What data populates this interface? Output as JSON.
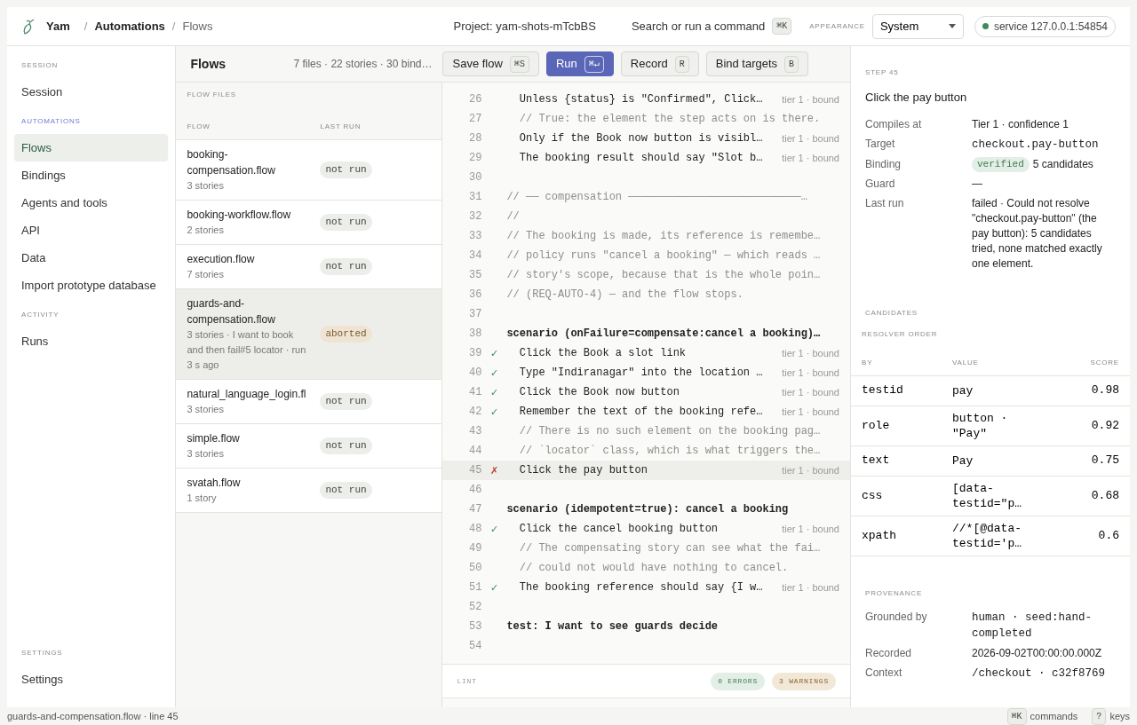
{
  "header": {
    "app": "Yam",
    "breadcrumbs": [
      {
        "separator": "/",
        "label": "Automations"
      },
      {
        "separator": "/",
        "label": "Flows"
      }
    ],
    "project": "Project: yam-shots-mTcbBS",
    "command": {
      "label": "Search or run a command",
      "key": "⌘K"
    },
    "appearance": {
      "label": "APPEARANCE",
      "value": "System"
    },
    "service": {
      "label": "service 127.0.0.1:54854",
      "color": "#3f8a5c"
    }
  },
  "sidebar": [
    {
      "heading": "SESSION",
      "accent": false,
      "items": [
        {
          "label": "Session",
          "selected": false
        }
      ]
    },
    {
      "heading": "AUTOMATIONS",
      "accent": true,
      "items": [
        {
          "label": "Flows",
          "selected": true
        },
        {
          "label": "Bindings",
          "selected": false
        },
        {
          "label": "Agents and tools",
          "selected": false
        },
        {
          "label": "API",
          "selected": false
        },
        {
          "label": "Data",
          "selected": false
        },
        {
          "label": "Import prototype database",
          "selected": false
        }
      ]
    },
    {
      "heading": "ACTIVITY",
      "accent": false,
      "items": [
        {
          "label": "Runs",
          "selected": false
        }
      ]
    }
  ],
  "sidebar_footer": {
    "heading": "SETTINGS",
    "items": [
      {
        "label": "Settings",
        "selected": false
      }
    ]
  },
  "toolbar": {
    "title": "Flows",
    "summary": "7 files · 22 stories · 30 bind…",
    "buttons": [
      {
        "label": "Save flow",
        "key": "⌘S",
        "primary": false
      },
      {
        "label": "Run",
        "key": "⌘↵",
        "primary": true
      },
      {
        "label": "Record",
        "key": "R",
        "primary": false
      },
      {
        "label": "Bind targets",
        "key": "B",
        "primary": false
      }
    ]
  },
  "flow_files": {
    "label": "FLOW FILES",
    "columns": [
      "FLOW",
      "LAST RUN"
    ],
    "rows": [
      {
        "name": "booking-compensation.flow",
        "detail": "3 stories",
        "status": "not run",
        "kind": "idle",
        "selected": false
      },
      {
        "name": "booking-workflow.flow",
        "detail": "2 stories",
        "status": "not run",
        "kind": "idle",
        "selected": false
      },
      {
        "name": "execution.flow",
        "detail": "7 stories",
        "status": "not run",
        "kind": "idle",
        "selected": false
      },
      {
        "name": "guards-and-compensation.flow",
        "detail": "3 stories · I want to book and then fail#5 locator · run 3 s ago",
        "status": "aborted",
        "kind": "aborted",
        "selected": true
      },
      {
        "name": "natural_language_login.fl",
        "detail": "3 stories",
        "status": "not run",
        "kind": "idle",
        "selected": false
      },
      {
        "name": "simple.flow",
        "detail": "3 stories",
        "status": "not run",
        "kind": "idle",
        "selected": false
      },
      {
        "name": "svatah.flow",
        "detail": "1 story",
        "status": "not run",
        "kind": "idle",
        "selected": false
      }
    ]
  },
  "editor": {
    "lines": [
      {
        "n": "26",
        "kind": "step",
        "text": "  Unless {status} is \"Confirmed\", Click…",
        "meta": "tier 1 · bound",
        "selected": false
      },
      {
        "n": "27",
        "kind": "comment",
        "text": "  // True: the element the step acts on is there.",
        "selected": false
      },
      {
        "n": "28",
        "kind": "step",
        "text": "  Only if the Book now button is visibl…",
        "meta": "tier 1 · bound",
        "selected": false
      },
      {
        "n": "29",
        "kind": "step",
        "text": "  The booking result should say \"Slot b…",
        "meta": "tier 1 · bound",
        "selected": false
      },
      {
        "n": "30",
        "kind": "blank",
        "selected": false
      },
      {
        "n": "31",
        "kind": "comment",
        "text": "// ── compensation ───────────────────────────…",
        "selected": false
      },
      {
        "n": "32",
        "kind": "comment",
        "text": "//",
        "selected": false
      },
      {
        "n": "33",
        "kind": "comment",
        "text": "// The booking is made, its reference is remembe…",
        "selected": false
      },
      {
        "n": "34",
        "kind": "comment",
        "text": "// policy runs \"cancel a booking\" — which reads …",
        "selected": false
      },
      {
        "n": "35",
        "kind": "comment",
        "text": "// story's scope, because that is the whole poin…",
        "selected": false
      },
      {
        "n": "36",
        "kind": "comment",
        "text": "// (REQ-AUTO-4) — and the flow stops.",
        "selected": false
      },
      {
        "n": "37",
        "kind": "blank",
        "selected": false
      },
      {
        "n": "38",
        "kind": "heading",
        "text": "scenario (onFailure=compensate:cancel a booking)…",
        "selected": false
      },
      {
        "n": "39",
        "kind": "step",
        "mark": "✓",
        "failed": false,
        "text": "  Click the Book a slot link",
        "meta": "tier 1 · bound",
        "selected": false
      },
      {
        "n": "40",
        "kind": "step",
        "mark": "✓",
        "failed": false,
        "text": "  Type \"Indiranagar\" into the location …",
        "meta": "tier 1 · bound",
        "selected": false
      },
      {
        "n": "41",
        "kind": "step",
        "mark": "✓",
        "failed": false,
        "text": "  Click the Book now button",
        "meta": "tier 1 · bound",
        "selected": false
      },
      {
        "n": "42",
        "kind": "step",
        "mark": "✓",
        "failed": false,
        "text": "  Remember the text of the booking refe…",
        "meta": "tier 1 · bound",
        "selected": false
      },
      {
        "n": "43",
        "kind": "comment",
        "text": "  // There is no such element on the booking pag…",
        "selected": false
      },
      {
        "n": "44",
        "kind": "comment",
        "text": "  // `locator` class, which is what triggers the…",
        "selected": false
      },
      {
        "n": "45",
        "kind": "step",
        "mark": "✗",
        "failed": true,
        "text": "  Click the pay button",
        "meta": "tier 1 · bound",
        "selected": true
      },
      {
        "n": "46",
        "kind": "blank",
        "selected": false
      },
      {
        "n": "47",
        "kind": "heading",
        "text": "scenario (idempotent=true): cancel a booking",
        "selected": false
      },
      {
        "n": "48",
        "kind": "step",
        "mark": "✓",
        "failed": false,
        "text": "  Click the cancel booking button",
        "meta": "tier 1 · bound",
        "selected": false
      },
      {
        "n": "49",
        "kind": "comment",
        "text": "  // The compensating story can see what the fai…",
        "selected": false
      },
      {
        "n": "50",
        "kind": "comment",
        "text": "  // could not would have nothing to cancel.",
        "selected": false
      },
      {
        "n": "51",
        "kind": "step",
        "mark": "✓",
        "failed": false,
        "text": "  The booking reference should say {I w…",
        "meta": "tier 1 · bound",
        "selected": false
      },
      {
        "n": "52",
        "kind": "blank",
        "selected": false
      },
      {
        "n": "53",
        "kind": "heading",
        "text": "test: I want to see guards decide",
        "selected": false
      },
      {
        "n": "54",
        "kind": "blank",
        "selected": false
      }
    ],
    "lint": {
      "label": "LINT",
      "badges": [
        {
          "label": "0 ERRORS",
          "kind": "ok"
        },
        {
          "label": "3 WARNINGS",
          "kind": "warn"
        }
      ]
    }
  },
  "step": {
    "label": "STEP 45",
    "title": "Click the pay button",
    "fields": [
      {
        "label": "Compiles at",
        "kind": "text",
        "value": "Tier 1 · confidence 1"
      },
      {
        "label": "Target",
        "kind": "code",
        "value": "checkout.pay-button"
      },
      {
        "label": "Binding",
        "kind": "badge",
        "badge": "verified",
        "value": "5 candidates"
      },
      {
        "label": "Guard",
        "kind": "text",
        "value": "—"
      },
      {
        "label": "Last run",
        "kind": "text",
        "value": "failed · Could not resolve \"checkout.pay-button\" (the pay button): 5 candidates tried, none matched exactly one element."
      }
    ]
  },
  "candidates": {
    "label": "CANDIDATES",
    "sublabel": "RESOLVER ORDER",
    "columns": [
      "BY",
      "VALUE",
      "SCORE"
    ],
    "rows": [
      {
        "by": "testid",
        "value": "pay",
        "score": "0.98"
      },
      {
        "by": "role",
        "value": "button · \"Pay\"",
        "score": "0.92"
      },
      {
        "by": "text",
        "value": "Pay",
        "score": "0.75"
      },
      {
        "by": "css",
        "value": "[data-testid=\"p…",
        "score": "0.68"
      },
      {
        "by": "xpath",
        "value": "//*[@data-testid='p…",
        "score": "0.6"
      }
    ]
  },
  "provenance": {
    "label": "PROVENANCE",
    "fields": [
      {
        "label": "Grounded by",
        "kind": "code",
        "value": "human · seed:hand-completed"
      },
      {
        "label": "Recorded",
        "kind": "text",
        "value": "2026-09-02T00:00:00.000Z"
      },
      {
        "label": "Context",
        "kind": "code",
        "value": "/checkout · c32f8769"
      }
    ]
  },
  "status_bar": {
    "text": "guards-and-compensation.flow · line 45",
    "shortcuts": [
      {
        "key": "⌘K",
        "label": "commands"
      },
      {
        "key": "?",
        "label": "keys"
      }
    ]
  }
}
